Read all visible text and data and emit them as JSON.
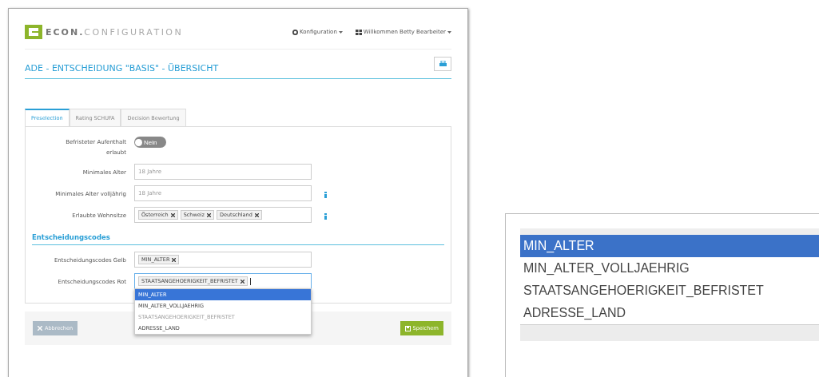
{
  "header": {
    "brand_primary": "ECON.",
    "brand_secondary": "CONFIGURATION",
    "menus": [
      {
        "label": "Konfiguration"
      },
      {
        "label": "Willkommen Betty Bearbeiter"
      }
    ]
  },
  "page_title": "ADE - ENTSCHEIDUNG \"BASIS\" - ÜBERSICHT",
  "tabs": [
    {
      "label": "Preselection",
      "selected": true
    },
    {
      "label": "Rating SCHUFA",
      "selected": false
    },
    {
      "label": "Decision Bewertung",
      "selected": false
    }
  ],
  "fields": [
    {
      "kind": "toggle",
      "label": "Befristeter Aufenthalt erlaubt",
      "on": false,
      "value": "Nein",
      "info": false
    },
    {
      "kind": "text",
      "label": "Minimales Alter",
      "placeholder": "18 Jahre",
      "info": false
    },
    {
      "kind": "text",
      "label": "Minimales Alter volljährig",
      "placeholder": "18 Jahre",
      "info": true
    },
    {
      "kind": "tags",
      "label": "Erlaubte Wohnsitze",
      "tags": [
        "Österreich",
        "Schweiz",
        "Deutschland"
      ],
      "info": true
    }
  ],
  "section_title": "Entscheidungscodes",
  "code_fields": [
    {
      "label": "Entscheidungscodes Gelb",
      "tags": [
        "MIN_ALTER"
      ],
      "focused": false
    },
    {
      "label": "Entscheidungscodes Rot",
      "tags": [
        "STAATSANGEHOERIGKEIT_BEFRISTET"
      ],
      "focused": true,
      "options": [
        {
          "label": "MIN_ALTER",
          "selected": true,
          "disabled": false
        },
        {
          "label": "MIN_ALTER_VOLLJAEHRIG",
          "selected": false,
          "disabled": false
        },
        {
          "label": "STAATSANGEHOERIGKEIT_BEFRISTET",
          "selected": false,
          "disabled": true
        },
        {
          "label": "ADRESSE_LAND",
          "selected": false,
          "disabled": false
        }
      ]
    }
  ],
  "buttons": [
    {
      "label": "Abbrechen",
      "kind": "cancel",
      "disabled": true
    },
    {
      "label": "Speichern",
      "kind": "save",
      "disabled": false
    }
  ],
  "zoom_inset": {
    "options": [
      {
        "label": "MIN_ALTER",
        "selected": true
      },
      {
        "label": "MIN_ALTER_VOLLJAEHRIG",
        "selected": false
      },
      {
        "label": "STAATSANGEHOERIGKEIT_BEFRISTET",
        "selected": false
      },
      {
        "label": "ADRESSE_LAND",
        "selected": false
      }
    ]
  }
}
